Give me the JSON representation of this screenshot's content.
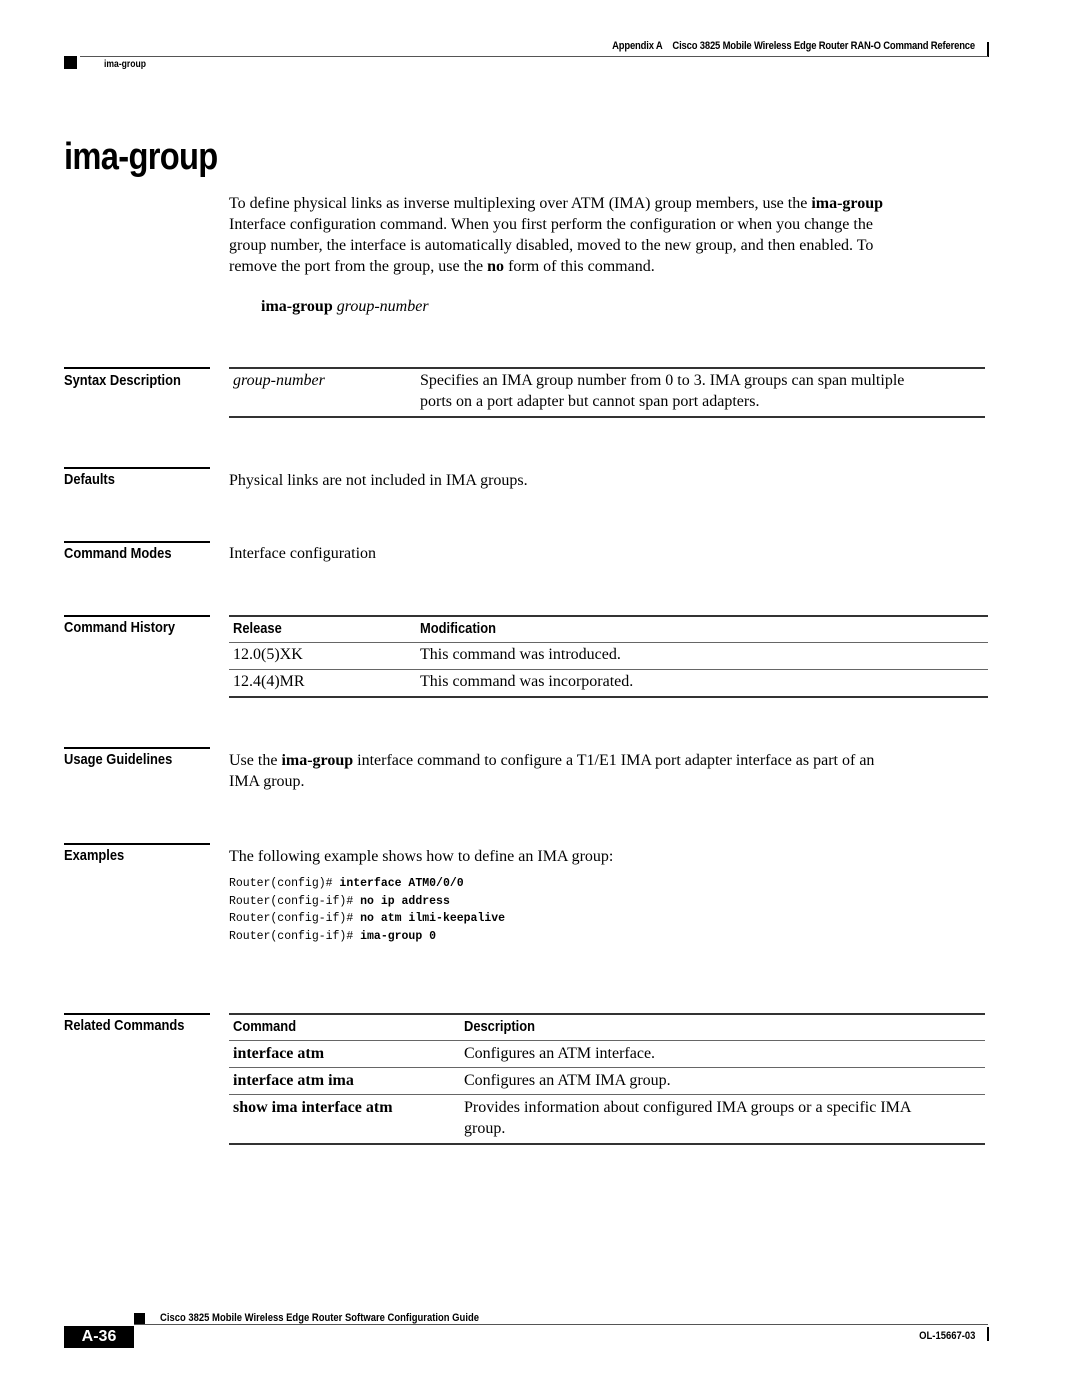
{
  "header": {
    "appendix": "Appendix A",
    "book_title": "Cisco 3825 Mobile Wireless Edge Router RAN-O Command Reference",
    "running_section": "ima-group"
  },
  "title": "ima-group",
  "intro": {
    "line1_pre": "To define physical links as inverse multiplexing over ATM (IMA) group members, use the ",
    "line1_bold": "ima-group",
    "line2": "Interface configuration command. When you first perform the configuration or when you change the",
    "line3": "group number, the interface is automatically disabled, moved to the new group, and then enabled. To",
    "line4_pre": "remove the port from the group, use the ",
    "line4_bold": "no",
    "line4_post": " form of this command."
  },
  "syntax": {
    "command": "ima-group",
    "argument": "group-number"
  },
  "sections": {
    "syntax_description": {
      "label": "Syntax Description",
      "rows": [
        {
          "term": "group-number",
          "desc_line1": "Specifies an IMA group number from 0 to 3. IMA groups can span multiple",
          "desc_line2": "ports on a port adapter but cannot span port adapters."
        }
      ]
    },
    "defaults": {
      "label": "Defaults",
      "text": "Physical links are not included in IMA groups."
    },
    "command_modes": {
      "label": "Command Modes",
      "text": "Interface configuration"
    },
    "command_history": {
      "label": "Command History",
      "columns": [
        "Release",
        "Modification"
      ],
      "rows": [
        {
          "release": "12.0(5)XK",
          "modification": "This command was introduced."
        },
        {
          "release": "12.4(4)MR",
          "modification": "This command was incorporated."
        }
      ]
    },
    "usage_guidelines": {
      "label": "Usage Guidelines",
      "line1_pre": "Use the ",
      "line1_bold": "ima-group",
      "line1_post": " interface command to configure a T1/E1 IMA port adapter interface as part of an",
      "line2": "IMA group."
    },
    "examples": {
      "label": "Examples",
      "intro": "The following example shows how to define an IMA group:",
      "code": [
        {
          "prompt": "Router(config)# ",
          "command": "interface ATM0/0/0"
        },
        {
          "prompt": "Router(config-if)# ",
          "command": "no ip address"
        },
        {
          "prompt": "Router(config-if)# ",
          "command": "no atm ilmi-keepalive"
        },
        {
          "prompt": "Router(config-if)# ",
          "command": "ima-group 0"
        }
      ]
    },
    "related_commands": {
      "label": "Related Commands",
      "columns": [
        "Command",
        "Description"
      ],
      "rows": [
        {
          "command": "interface atm",
          "description": "Configures an ATM interface.",
          "description2": ""
        },
        {
          "command": "interface atm ima",
          "description": "Configures an ATM IMA group.",
          "description2": ""
        },
        {
          "command": "show ima interface atm",
          "description": "Provides information about configured IMA groups or a specific IMA",
          "description2": "group."
        }
      ]
    }
  },
  "footer": {
    "guide_title": "Cisco 3825 Mobile Wireless Edge Router Software Configuration Guide",
    "page_number": "A-36",
    "doc_number": "OL-15667-03"
  }
}
